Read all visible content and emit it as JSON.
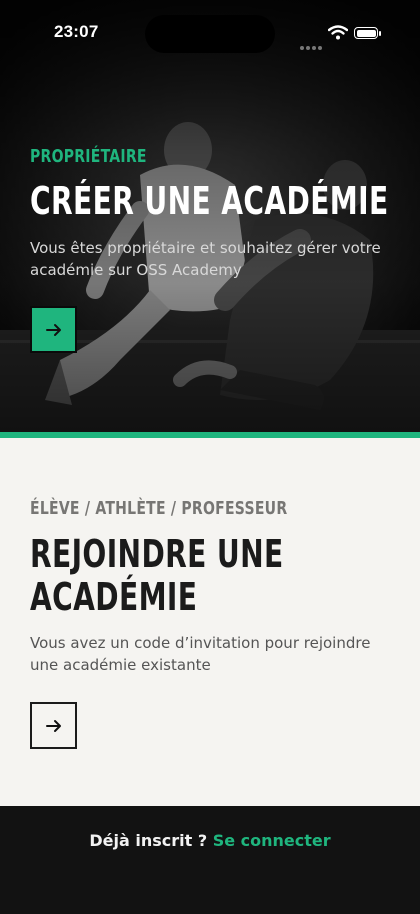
{
  "status_bar": {
    "time": "23:07"
  },
  "owner_section": {
    "eyebrow": "PROPRIÉTAIRE",
    "title": "CRÉER UNE ACADÉMIE",
    "description": "Vous êtes propriétaire et souhaitez gérer votre académie sur OSS Academy",
    "button_icon": "arrow-right-icon"
  },
  "member_section": {
    "eyebrow": "ÉLÈVE / ATHLÈTE / PROFESSEUR",
    "title_line1": "REJOINDRE UNE",
    "title_line2": "ACADÉMIE",
    "description": "Vous avez un code d’invitation pour rejoindre une académie existante",
    "button_icon": "arrow-right-icon"
  },
  "footer": {
    "question": "Déjà inscrit ?",
    "link": "Se connecter"
  },
  "colors": {
    "accent": "#1fb57e",
    "dark": "#121212",
    "light_bg": "#f5f4f1"
  }
}
